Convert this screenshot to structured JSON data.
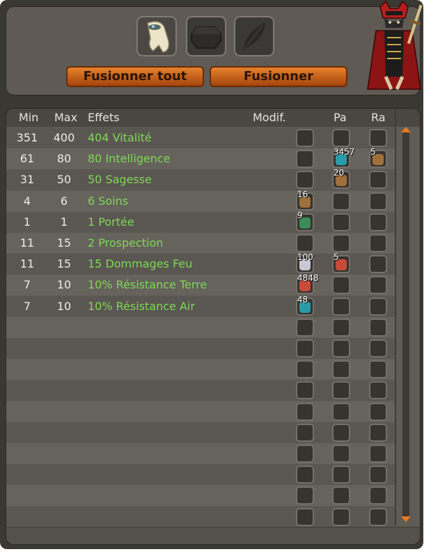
{
  "buttons": {
    "merge_all": "Fusionner tout",
    "merge": "Fusionner"
  },
  "slots": [
    "item-slot",
    "rune-slot",
    "feather-slot"
  ],
  "table": {
    "headers": {
      "min": "Min",
      "max": "Max",
      "effects": "Effets",
      "modif": "Modif.",
      "pa": "Pa",
      "ra": "Ra"
    },
    "rows": [
      {
        "min": "351",
        "max": "400",
        "effect": "404 Vitalité",
        "modif": "",
        "pa": "",
        "ra": ""
      },
      {
        "min": "61",
        "max": "80",
        "effect": "80 Intelligence",
        "modif": "",
        "pa": "3457",
        "ra": "5"
      },
      {
        "min": "31",
        "max": "50",
        "effect": "50 Sagesse",
        "modif": "",
        "pa": "20",
        "ra": ""
      },
      {
        "min": "4",
        "max": "6",
        "effect": "6 Soins",
        "modif": "16",
        "pa": "",
        "ra": ""
      },
      {
        "min": "1",
        "max": "1",
        "effect": "1 Portée",
        "modif": "9",
        "pa": "",
        "ra": ""
      },
      {
        "min": "11",
        "max": "15",
        "effect": "2 Prospection",
        "modif": "",
        "pa": "",
        "ra": ""
      },
      {
        "min": "11",
        "max": "15",
        "effect": "15 Dommages Feu",
        "modif": "100",
        "pa": "5",
        "ra": ""
      },
      {
        "min": "7",
        "max": "10",
        "effect": "10% Résistance Terre",
        "modif": "4848",
        "pa": "",
        "ra": ""
      },
      {
        "min": "7",
        "max": "10",
        "effect": "10% Résistance Air",
        "modif": "48",
        "pa": "",
        "ra": ""
      }
    ],
    "empty_rows": 10
  },
  "colors": {
    "effect_green": "#7ed957",
    "button_orange": "#d9691f",
    "scroll_orange": "#f07a1c"
  }
}
